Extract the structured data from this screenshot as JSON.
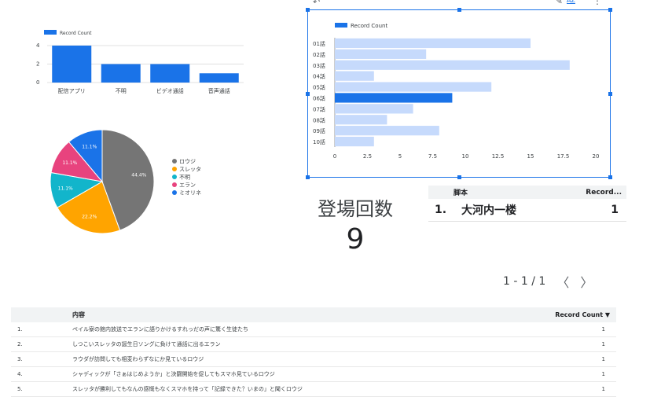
{
  "toolbar": {
    "edit_icon": "pencil-icon",
    "sort_label": "AZ",
    "more_icon": "more-vert-icon"
  },
  "chart_data": [
    {
      "type": "bar",
      "legend": [
        "Record Count"
      ],
      "categories": [
        "配信アプリ",
        "不明",
        "ビデオ通話",
        "音声通話"
      ],
      "values": [
        4,
        2,
        2,
        1
      ],
      "yticks": [
        "0",
        "2",
        "4"
      ],
      "ylim": [
        0,
        4
      ],
      "color": "#1a73e8"
    },
    {
      "type": "pie",
      "slices": [
        {
          "name": "ロウジ",
          "value": 44.4,
          "label": "44.4%",
          "color": "#757575"
        },
        {
          "name": "スレッタ",
          "value": 22.2,
          "label": "22.2%",
          "color": "#ffa400"
        },
        {
          "name": "不明",
          "value": 11.1,
          "label": "11.1%",
          "color": "#12b5cb"
        },
        {
          "name": "エラン",
          "value": 11.1,
          "label": "11.1%",
          "color": "#e8437e"
        },
        {
          "name": "ミオリネ",
          "value": 11.1,
          "label": "11.1%",
          "color": "#1a73e8"
        }
      ]
    },
    {
      "type": "bar",
      "orientation": "horizontal",
      "legend": [
        "Record Count"
      ],
      "categories": [
        "01話",
        "02話",
        "03話",
        "04話",
        "05話",
        "06話",
        "07話",
        "08話",
        "09話",
        "10話"
      ],
      "values": [
        15,
        7,
        18,
        3,
        12,
        9,
        6,
        4,
        8,
        3
      ],
      "highlight_index": 5,
      "xticks": [
        "0",
        "2.5",
        "5",
        "7.5",
        "10",
        "12.5",
        "15",
        "17.5",
        "20"
      ],
      "xlim": [
        0,
        20
      ],
      "color": "#c6dafc",
      "highlight_color": "#1a73e8"
    }
  ],
  "scorecard": {
    "label": "登場回数",
    "value": "9"
  },
  "small_table": {
    "headers": [
      "脚本",
      "Record..."
    ],
    "rows": [
      {
        "num": "1.",
        "text": "大河内一楼",
        "count": "1"
      }
    ]
  },
  "pagination": {
    "text": "1 - 1 / 1",
    "prev": "〈",
    "next": "〉"
  },
  "big_table": {
    "headers": [
      "内容",
      "Record Count ▼"
    ],
    "rows": [
      {
        "num": "1.",
        "text": "ペイル寮の館内放送でエランに語りかけるすれっだの声に驚く生徒たち",
        "count": "1"
      },
      {
        "num": "2.",
        "text": "しつこいスレッタの誕生日ソングに負けて通話に出るエラン",
        "count": "1"
      },
      {
        "num": "3.",
        "text": "ラウダが訪問しても相変わらずなにか見ているロウジ",
        "count": "1"
      },
      {
        "num": "4.",
        "text": "シャディックが「さぁはじめようか」と決闘開始を促してもスマホ見ているロウジ",
        "count": "1"
      },
      {
        "num": "5.",
        "text": "スレッタが勝利してもなんの感慨もなくスマホを持って「記録できた？いまの」と聞くロウジ",
        "count": "1"
      }
    ]
  }
}
